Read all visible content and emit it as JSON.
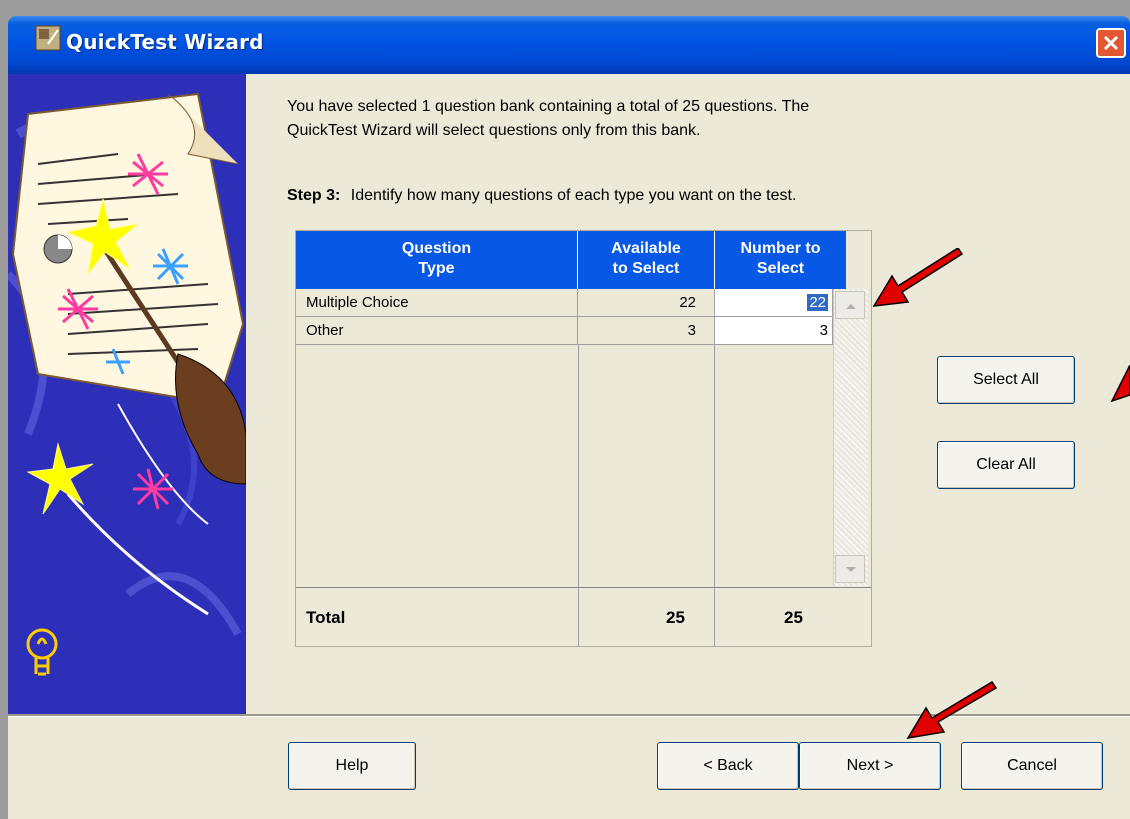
{
  "window": {
    "title": "QuickTest Wizard"
  },
  "intro": {
    "line1": "You have selected 1 question bank containing a total of 25 questions.  The",
    "line2": "QuickTest Wizard will select questions only from this bank."
  },
  "step": {
    "label": "Step 3:",
    "text": "Identify how many questions of each type you want on the test."
  },
  "table": {
    "headers": {
      "type": [
        "Question",
        "Type"
      ],
      "available": [
        "Available",
        "to Select"
      ],
      "number": [
        "Number to",
        "Select"
      ]
    },
    "rows": [
      {
        "type": "Multiple Choice",
        "available": "22",
        "number": "22"
      },
      {
        "type": "Other",
        "available": "3",
        "number": "3"
      }
    ],
    "total": {
      "label": "Total",
      "available": "25",
      "number": "25"
    }
  },
  "buttons": {
    "select_all": "Select All",
    "clear_all": "Clear All",
    "help": "Help",
    "back": "< Back",
    "next": "Next >",
    "cancel": "Cancel"
  },
  "colors": {
    "titlebar": "#0054e3",
    "header": "#0858e6",
    "sidebar": "#2d2fb8",
    "arrow": "#e00000"
  }
}
